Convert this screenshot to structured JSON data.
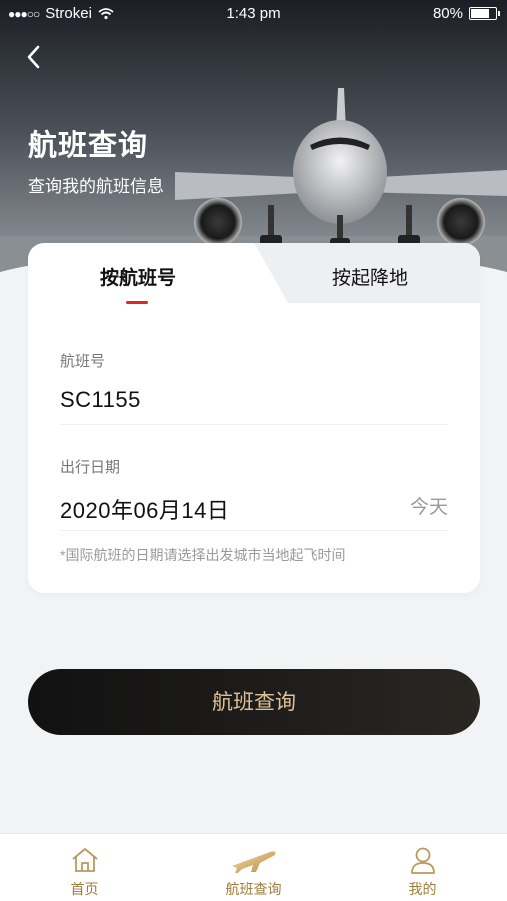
{
  "status_bar": {
    "carrier": "Strokei",
    "time": "1:43 pm",
    "battery": "80%",
    "battery_level": 0.8
  },
  "header": {
    "title": "航班查询",
    "subtitle": "查询我的航班信息"
  },
  "tabs": {
    "by_flight": "按航班号",
    "by_city": "按起降地"
  },
  "form": {
    "flight_no_label": "航班号",
    "flight_no_value": "SC1155",
    "date_label": "出行日期",
    "date_value": "2020年06月14日",
    "today_label": "今天",
    "note": "*国际航班的日期请选择出发城市当地起飞时间"
  },
  "search_button": "航班查询",
  "bottom_nav": {
    "home": "首页",
    "flight_query": "航班查询",
    "mine": "我的"
  },
  "colors": {
    "accent_red": "#e02626",
    "gold": "#dcc397",
    "nav_gold": "#a07c3a",
    "button_dark": "#111111"
  },
  "icons": [
    "back-arrow-icon",
    "wifi-icon",
    "battery-icon",
    "home-icon",
    "plane-icon",
    "user-icon"
  ]
}
